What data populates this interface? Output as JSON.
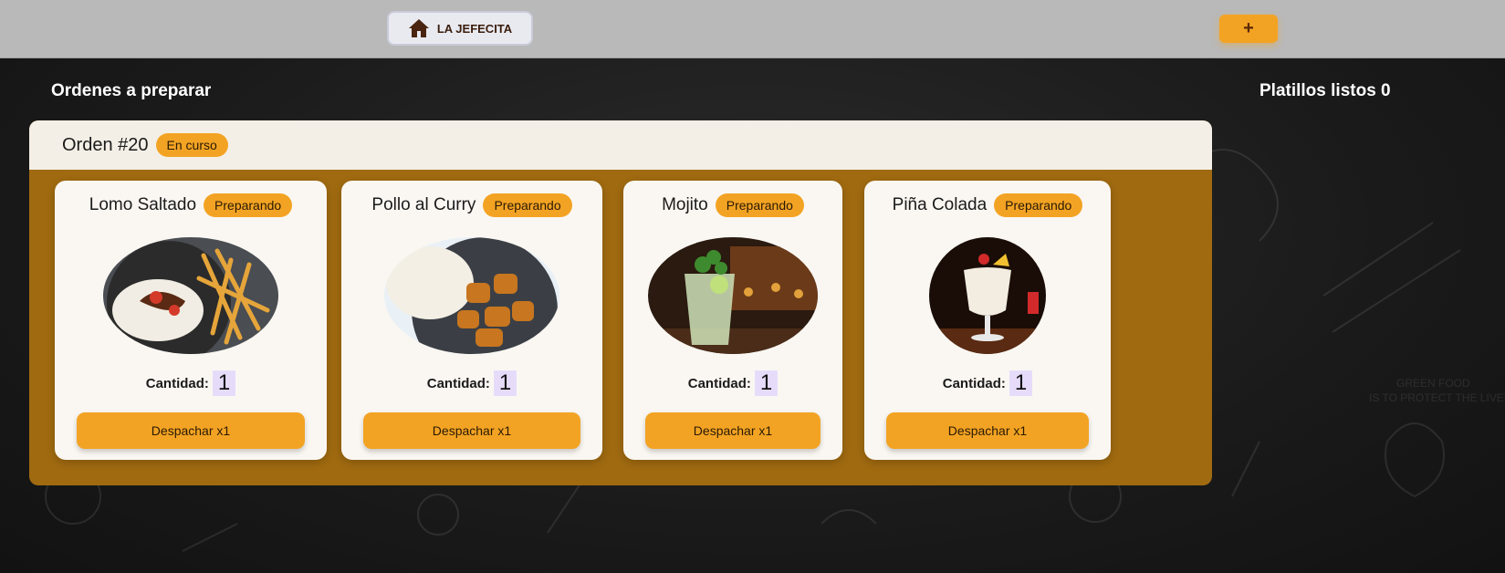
{
  "header": {
    "home_label": "LA JEFECITA",
    "add_label": "+"
  },
  "sections": {
    "pending_title": "Ordenes a preparar",
    "ready_title": "Platillos listos 0"
  },
  "order": {
    "title": "Orden #20",
    "status": "En curso",
    "items": [
      {
        "name": "Lomo Saltado",
        "status": "Preparando",
        "qty_label": "Cantidad:",
        "qty": "1",
        "button": "Despachar x1"
      },
      {
        "name": "Pollo al Curry",
        "status": "Preparando",
        "qty_label": "Cantidad:",
        "qty": "1",
        "button": "Despachar x1"
      },
      {
        "name": "Mojito",
        "status": "Preparando",
        "qty_label": "Cantidad:",
        "qty": "1",
        "button": "Despachar x1"
      },
      {
        "name": "Piña Colada",
        "status": "Preparando",
        "qty_label": "Cantidad:",
        "qty": "1",
        "button": "Despachar x1"
      }
    ]
  },
  "colors": {
    "accent": "#f3a323",
    "order_body": "#a06a10",
    "topbar": "#b9b9b9"
  }
}
